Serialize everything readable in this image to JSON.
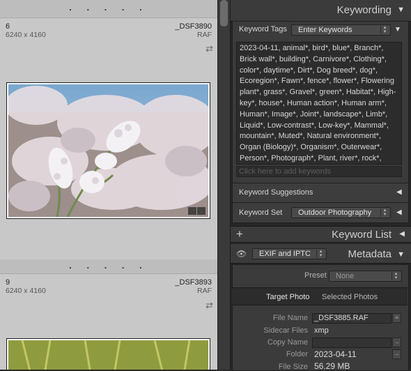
{
  "grid": {
    "top_dots": ". . . . .",
    "cells": [
      {
        "number": "6",
        "dimensions": "6240 x 4160",
        "filename": "_DSF3890",
        "filetype": "RAF"
      },
      {
        "number": "9",
        "dimensions": "6240 x 4160",
        "filename": "_DSF3893",
        "filetype": "RAF"
      }
    ],
    "mid_dots": ". . . . ."
  },
  "keywording": {
    "title": "Keywording",
    "tags_label": "Keyword Tags",
    "tags_mode": "Enter Keywords",
    "keywords_text": "2023-04-11, animal*, bird*, blue*, Branch*, Brick wall*, building*, Carnivore*, Clothing*, color*, daytime*, Dirt*, Dog breed*, dog*, Ecoregion*, Fawn*, fence*, flower*, Flowering plant*, grass*, Gravel*, green*, Habitat*, High-key*, house*, Human action*, Human arm*, Human*, Image*, Joint*, landscape*, Limb*, Liquid*, Low-contrast*, Low-key*, Mammal*, mountain*, Muted*, Natural environment*, Organ (Biology)*, Organism*, Outerwear*, Person*, Photograph*, Plant, river*, rock*, Sense*, Shoe*, sidewalk*, Skin*, sky*, T-shirt*, Terrestrial plant*, tree, Vertebrate*, Vivid*,",
    "add_placeholder": "Click here to add keywords",
    "suggestions_label": "Keyword Suggestions",
    "set_label": "Keyword Set",
    "set_value": "Outdoor Photography"
  },
  "keyword_list": {
    "plus": "+",
    "title": "Keyword List"
  },
  "metadata": {
    "title": "Metadata",
    "preset_dropdown": "EXIF and IPTC",
    "preset_label": "Preset",
    "preset_value": "None",
    "target_tab": "Target Photo",
    "selected_tab": "Selected Photos",
    "fields": [
      {
        "label": "File Name",
        "value": "_DSF3885.RAF"
      },
      {
        "label": "Sidecar Files",
        "value": "xmp"
      },
      {
        "label": "Copy Name",
        "value": ""
      },
      {
        "label": "Folder",
        "value": "2023-04-11"
      },
      {
        "label": "File Size",
        "value": "56.29 MB"
      }
    ]
  },
  "icons": {
    "swap": "swap-arrows-icon",
    "eye": "eye-icon",
    "collapse": "triangle-down-icon",
    "expand": "triangle-left-icon"
  },
  "colors": {
    "panel_bg": "#262626",
    "header_bg": "#3b3b3b",
    "grid_bg": "#bdbdbd"
  }
}
